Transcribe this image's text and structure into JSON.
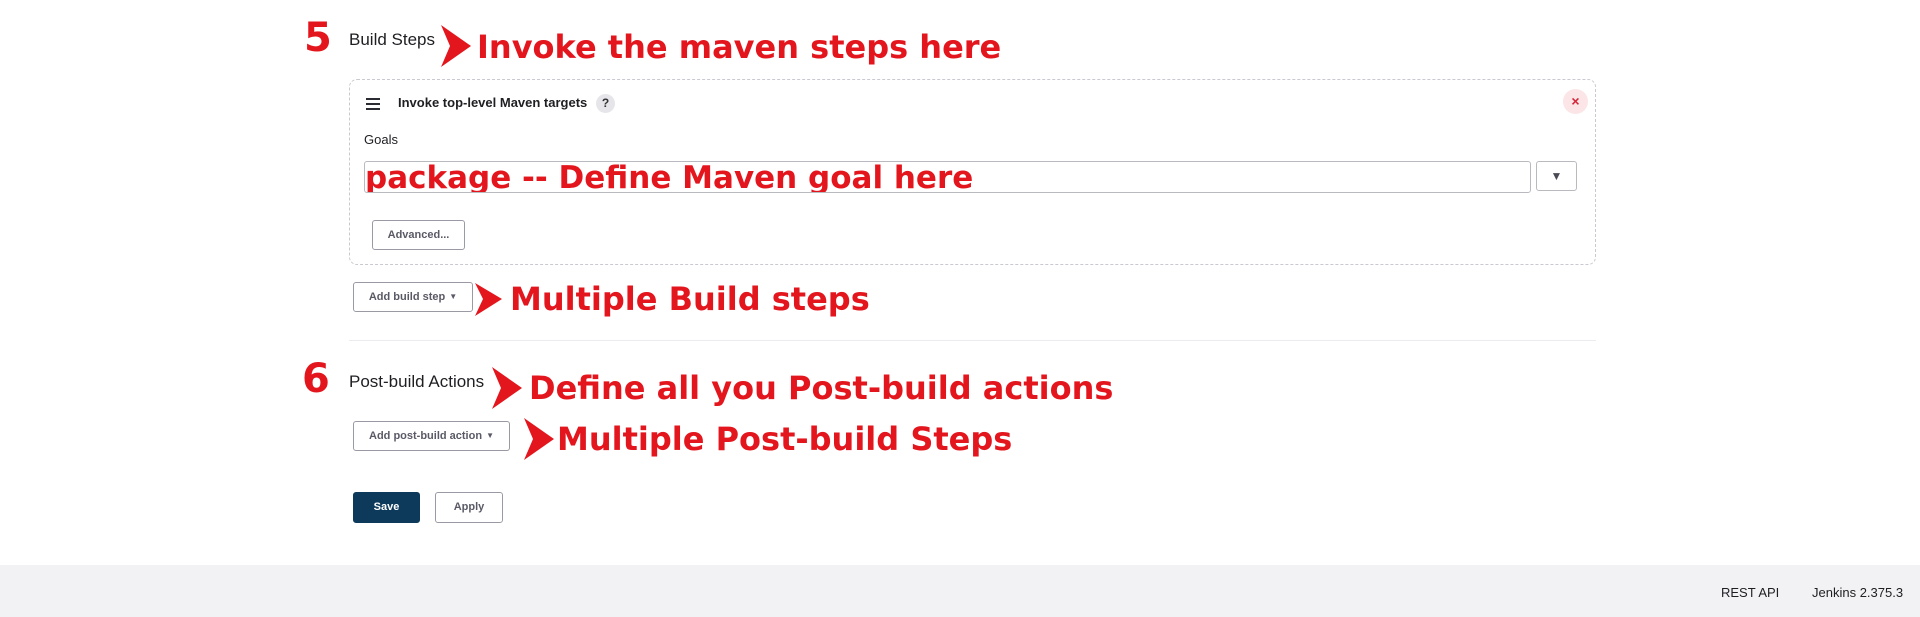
{
  "annotations": {
    "step5_number": "5",
    "step5_text": "Invoke the maven steps here",
    "goal_text": "package -- Define Maven goal here",
    "multiple_build_steps": "Multiple Build steps",
    "step6_number": "6",
    "post_build_text": "Define all you Post-build actions",
    "multiple_post_build": "Multiple Post-build Steps",
    "color": "#e3161e"
  },
  "build_steps": {
    "title": "Build Steps",
    "step": {
      "title": "Invoke top-level Maven targets",
      "help_icon": "?",
      "close_icon": "×",
      "goals_label": "Goals",
      "goals_value": "",
      "expand_icon": "▼",
      "advanced_label": "Advanced..."
    },
    "add_build_step_label": "Add build step"
  },
  "post_build": {
    "title": "Post-build Actions",
    "add_post_build_label": "Add post-build action"
  },
  "actions": {
    "save_label": "Save",
    "apply_label": "Apply",
    "primary_color": "#0d3a5b"
  },
  "footer": {
    "rest_api_label": "REST API",
    "version_label": "Jenkins 2.375.3"
  }
}
